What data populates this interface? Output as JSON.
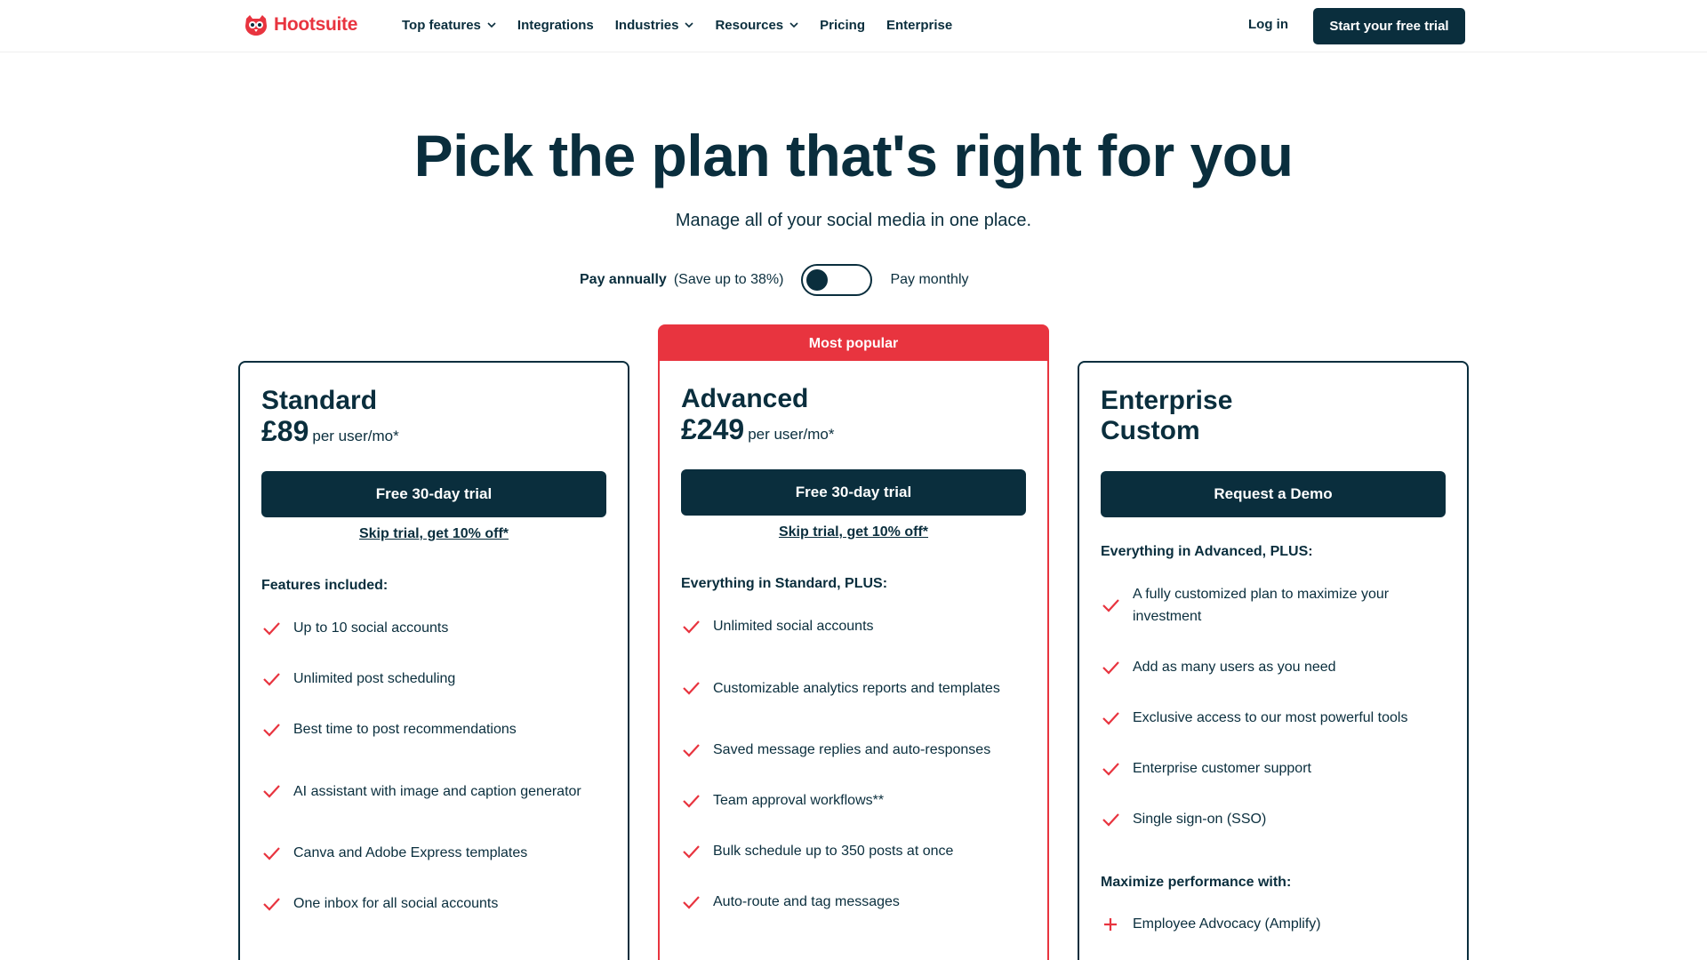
{
  "brand": {
    "name": "Hootsuite",
    "accent": "#e8343f",
    "navy": "#0a2e3d"
  },
  "nav": {
    "items": [
      {
        "label": "Top features",
        "has_dropdown": true
      },
      {
        "label": "Integrations",
        "has_dropdown": false
      },
      {
        "label": "Industries",
        "has_dropdown": true
      },
      {
        "label": "Resources",
        "has_dropdown": true
      },
      {
        "label": "Pricing",
        "has_dropdown": false
      },
      {
        "label": "Enterprise",
        "has_dropdown": false
      }
    ],
    "login": "Log in",
    "cta": "Start your free trial"
  },
  "hero": {
    "title": "Pick the plan that's right for you",
    "subtitle": "Manage all of your social media in one place."
  },
  "billing": {
    "annual": "Pay annually",
    "savings": "(Save up to 38%)",
    "monthly": "Pay monthly",
    "selected": "annual"
  },
  "plans": [
    {
      "name": "Standard",
      "price": "£89",
      "per": "per user/mo*",
      "button": "Free 30-day trial",
      "skip": "Skip trial, get 10% off*",
      "features_heading": "Features included:",
      "features": [
        "Up to 10 social accounts",
        "Unlimited post scheduling",
        "Best time to post recommendations",
        "AI assistant with image and caption generator",
        "Canva and Adobe Express templates",
        "One inbox for all social accounts"
      ]
    },
    {
      "name": "Advanced",
      "badge": "Most popular",
      "price": "£249",
      "per": "per user/mo*",
      "button": "Free 30-day trial",
      "skip": "Skip trial, get 10% off*",
      "features_heading": "Everything in Standard, PLUS:",
      "features": [
        "Unlimited social accounts",
        "Customizable analytics reports and templates",
        "Saved message replies and auto-responses",
        "Team approval workflows**",
        "Bulk schedule up to 350 posts at once",
        "Auto-route and tag messages"
      ]
    },
    {
      "name": "Enterprise",
      "price_label": "Custom",
      "button": "Request a Demo",
      "features_heading": "Everything in Advanced, PLUS:",
      "features": [
        "A fully customized plan to maximize your investment",
        "Add as many users as you need",
        "Exclusive access to our most powerful tools",
        "Enterprise customer support",
        "Single sign-on (SSO)"
      ],
      "addons_heading": "Maximize performance with:",
      "addons": [
        "Employee Advocacy (Amplify)"
      ]
    }
  ]
}
